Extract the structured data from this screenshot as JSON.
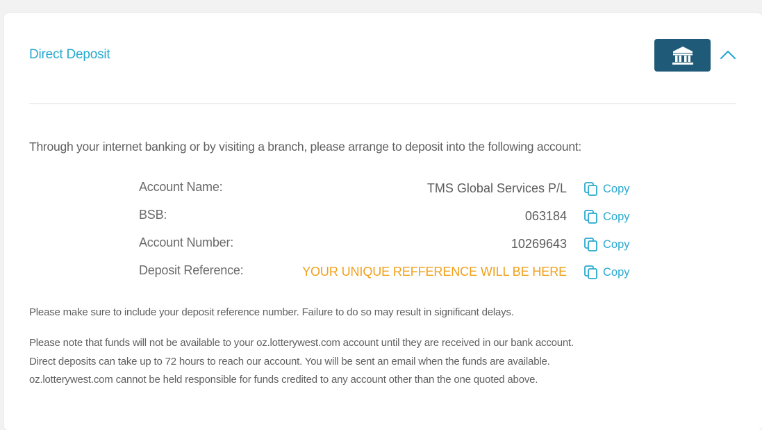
{
  "section": {
    "title": "Direct Deposit",
    "icons": {
      "bank": "bank-icon",
      "collapse": "chevron-up-icon",
      "copy": "copy-icon"
    }
  },
  "colors": {
    "accent": "#29a9cf",
    "button": "#1f5b78",
    "reference": "#f0a01a"
  },
  "instructions": "Through your internet banking or by visiting a branch, please arrange to deposit into the following account:",
  "account": [
    {
      "label": "Account Name:",
      "value": "TMS Global Services P/L",
      "copy": "Copy"
    },
    {
      "label": "BSB:",
      "value": "063184",
      "copy": "Copy"
    },
    {
      "label": "Account Number:",
      "value": "10269643",
      "copy": "Copy"
    },
    {
      "label": "Deposit Reference:",
      "value": "YOUR UNIQUE REFFERENCE WILL BE HERE",
      "copy": "Copy"
    }
  ],
  "notes": {
    "warning": "Please make sure to include your deposit reference number. Failure to do so may result in significant delays.",
    "lines": [
      "Please note that funds will not be available to your oz.lotterywest.com account until they are received in our bank account.",
      "Direct deposits can take up to 72 hours to reach our account. You will be sent an email when the funds are available.",
      "oz.lotterywest.com cannot be held responsible for funds credited to any account other than the one quoted above."
    ]
  }
}
